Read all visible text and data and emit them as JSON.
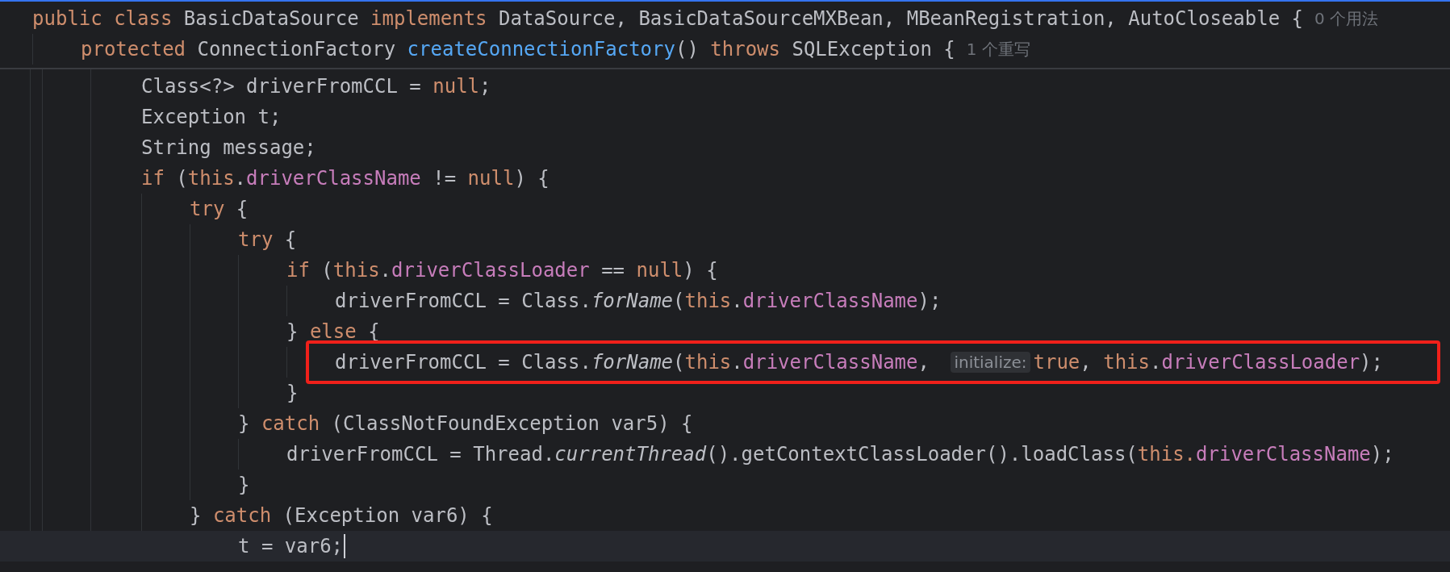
{
  "sticky_lines": [
    {
      "current": false,
      "highlighted": false,
      "tokens": [
        {
          "text": "public class ",
          "kind": "keyword"
        },
        {
          "text": "BasicDataSource ",
          "kind": "plain"
        },
        {
          "text": "implements ",
          "kind": "keyword"
        },
        {
          "text": "DataSource, BasicDataSourceMXBean, MBeanRegistration, AutoCloseable {",
          "kind": "plain"
        },
        {
          "text": "0 个用法",
          "kind": "usage_hint"
        }
      ],
      "children": [
        {
          "current": false,
          "highlighted": false,
          "tokens": [
            {
              "text": "protected ",
              "kind": "keyword"
            },
            {
              "text": "ConnectionFactory ",
              "kind": "plain"
            },
            {
              "text": "createConnectionFactory",
              "kind": "method"
            },
            {
              "text": "() ",
              "kind": "plain"
            },
            {
              "text": "throws ",
              "kind": "keyword"
            },
            {
              "text": "SQLException {",
              "kind": "plain"
            },
            {
              "text": "1 个重写",
              "kind": "usage_hint"
            }
          ]
        }
      ]
    }
  ],
  "lines": [
    {
      "current": false,
      "highlighted": false,
      "tokens": [
        {
          "text": "Class<?> driverFromCCL = ",
          "kind": "plain"
        },
        {
          "text": "null",
          "kind": "keyword"
        },
        {
          "text": ";",
          "kind": "plain"
        }
      ]
    },
    {
      "current": false,
      "highlighted": false,
      "tokens": [
        {
          "text": "Exception t;",
          "kind": "plain"
        }
      ]
    },
    {
      "current": false,
      "highlighted": false,
      "tokens": [
        {
          "text": "String message;",
          "kind": "plain"
        }
      ]
    },
    {
      "current": false,
      "highlighted": false,
      "tokens": [
        {
          "text": "if ",
          "kind": "keyword"
        },
        {
          "text": "(",
          "kind": "plain"
        },
        {
          "text": "this",
          "kind": "keyword"
        },
        {
          "text": ".",
          "kind": "plain"
        },
        {
          "text": "driverClassName",
          "kind": "field"
        },
        {
          "text": " != ",
          "kind": "plain"
        },
        {
          "text": "null",
          "kind": "keyword"
        },
        {
          "text": ") {",
          "kind": "plain"
        }
      ],
      "children": [
        {
          "current": false,
          "highlighted": false,
          "tokens": [
            {
              "text": "try ",
              "kind": "keyword"
            },
            {
              "text": "{",
              "kind": "plain"
            }
          ],
          "children": [
            {
              "current": false,
              "highlighted": false,
              "tokens": [
                {
                  "text": "try ",
                  "kind": "keyword"
                },
                {
                  "text": "{",
                  "kind": "plain"
                }
              ],
              "children": [
                {
                  "current": false,
                  "highlighted": false,
                  "tokens": [
                    {
                      "text": "if ",
                      "kind": "keyword"
                    },
                    {
                      "text": "(",
                      "kind": "plain"
                    },
                    {
                      "text": "this",
                      "kind": "keyword"
                    },
                    {
                      "text": ".",
                      "kind": "plain"
                    },
                    {
                      "text": "driverClassLoader",
                      "kind": "field"
                    },
                    {
                      "text": " == ",
                      "kind": "plain"
                    },
                    {
                      "text": "null",
                      "kind": "keyword"
                    },
                    {
                      "text": ") {",
                      "kind": "plain"
                    }
                  ],
                  "children": [
                    {
                      "current": false,
                      "highlighted": false,
                      "tokens": [
                        {
                          "text": "driverFromCCL = Class.",
                          "kind": "plain"
                        },
                        {
                          "text": "forName",
                          "kind": "static_call"
                        },
                        {
                          "text": "(",
                          "kind": "plain"
                        },
                        {
                          "text": "this",
                          "kind": "keyword"
                        },
                        {
                          "text": ".",
                          "kind": "plain"
                        },
                        {
                          "text": "driverClassName",
                          "kind": "field"
                        },
                        {
                          "text": ");",
                          "kind": "plain"
                        }
                      ]
                    }
                  ]
                },
                {
                  "current": false,
                  "highlighted": false,
                  "tokens": [
                    {
                      "text": "} ",
                      "kind": "plain"
                    },
                    {
                      "text": "else ",
                      "kind": "keyword"
                    },
                    {
                      "text": "{",
                      "kind": "plain"
                    }
                  ],
                  "children": [
                    {
                      "current": false,
                      "highlighted": true,
                      "tokens": [
                        {
                          "text": "driverFromCCL = Class.",
                          "kind": "plain"
                        },
                        {
                          "text": "forName",
                          "kind": "static_call"
                        },
                        {
                          "text": "(",
                          "kind": "plain"
                        },
                        {
                          "text": "this",
                          "kind": "keyword"
                        },
                        {
                          "text": ".",
                          "kind": "plain"
                        },
                        {
                          "text": "driverClassName",
                          "kind": "field"
                        },
                        {
                          "text": ", ",
                          "kind": "plain"
                        },
                        {
                          "text": "initialize:",
                          "kind": "param_hint"
                        },
                        {
                          "text": "true",
                          "kind": "keyword"
                        },
                        {
                          "text": ", ",
                          "kind": "plain"
                        },
                        {
                          "text": "this",
                          "kind": "keyword"
                        },
                        {
                          "text": ".",
                          "kind": "plain"
                        },
                        {
                          "text": "driverClassLoader",
                          "kind": "field"
                        },
                        {
                          "text": ");",
                          "kind": "plain"
                        }
                      ]
                    }
                  ]
                },
                {
                  "current": false,
                  "highlighted": false,
                  "tokens": [
                    {
                      "text": "}",
                      "kind": "plain"
                    }
                  ]
                }
              ]
            },
            {
              "current": false,
              "highlighted": false,
              "tokens": [
                {
                  "text": "} ",
                  "kind": "plain"
                },
                {
                  "text": "catch ",
                  "kind": "keyword"
                },
                {
                  "text": "(ClassNotFoundException var5) {",
                  "kind": "plain"
                }
              ],
              "children": [
                {
                  "current": false,
                  "highlighted": false,
                  "tokens": [
                    {
                      "text": "driverFromCCL = Thread.",
                      "kind": "plain"
                    },
                    {
                      "text": "currentThread",
                      "kind": "static_call"
                    },
                    {
                      "text": "().getContextClassLoader().loadClass(",
                      "kind": "plain"
                    },
                    {
                      "text": "this.",
                      "kind": "keyword"
                    },
                    {
                      "text": "driverClassName",
                      "kind": "field"
                    },
                    {
                      "text": ");",
                      "kind": "plain"
                    }
                  ]
                }
              ]
            },
            {
              "current": false,
              "highlighted": false,
              "tokens": [
                {
                  "text": "}",
                  "kind": "plain"
                }
              ]
            }
          ]
        },
        {
          "current": false,
          "highlighted": false,
          "tokens": [
            {
              "text": "} ",
              "kind": "plain"
            },
            {
              "text": "catch ",
              "kind": "keyword"
            },
            {
              "text": "(Exception var6) {",
              "kind": "plain"
            }
          ],
          "children": [
            {
              "current": true,
              "highlighted": false,
              "tokens": [
                {
                  "text": "t = var6;",
                  "kind": "plain"
                }
              ]
            }
          ]
        }
      ]
    }
  ]
}
